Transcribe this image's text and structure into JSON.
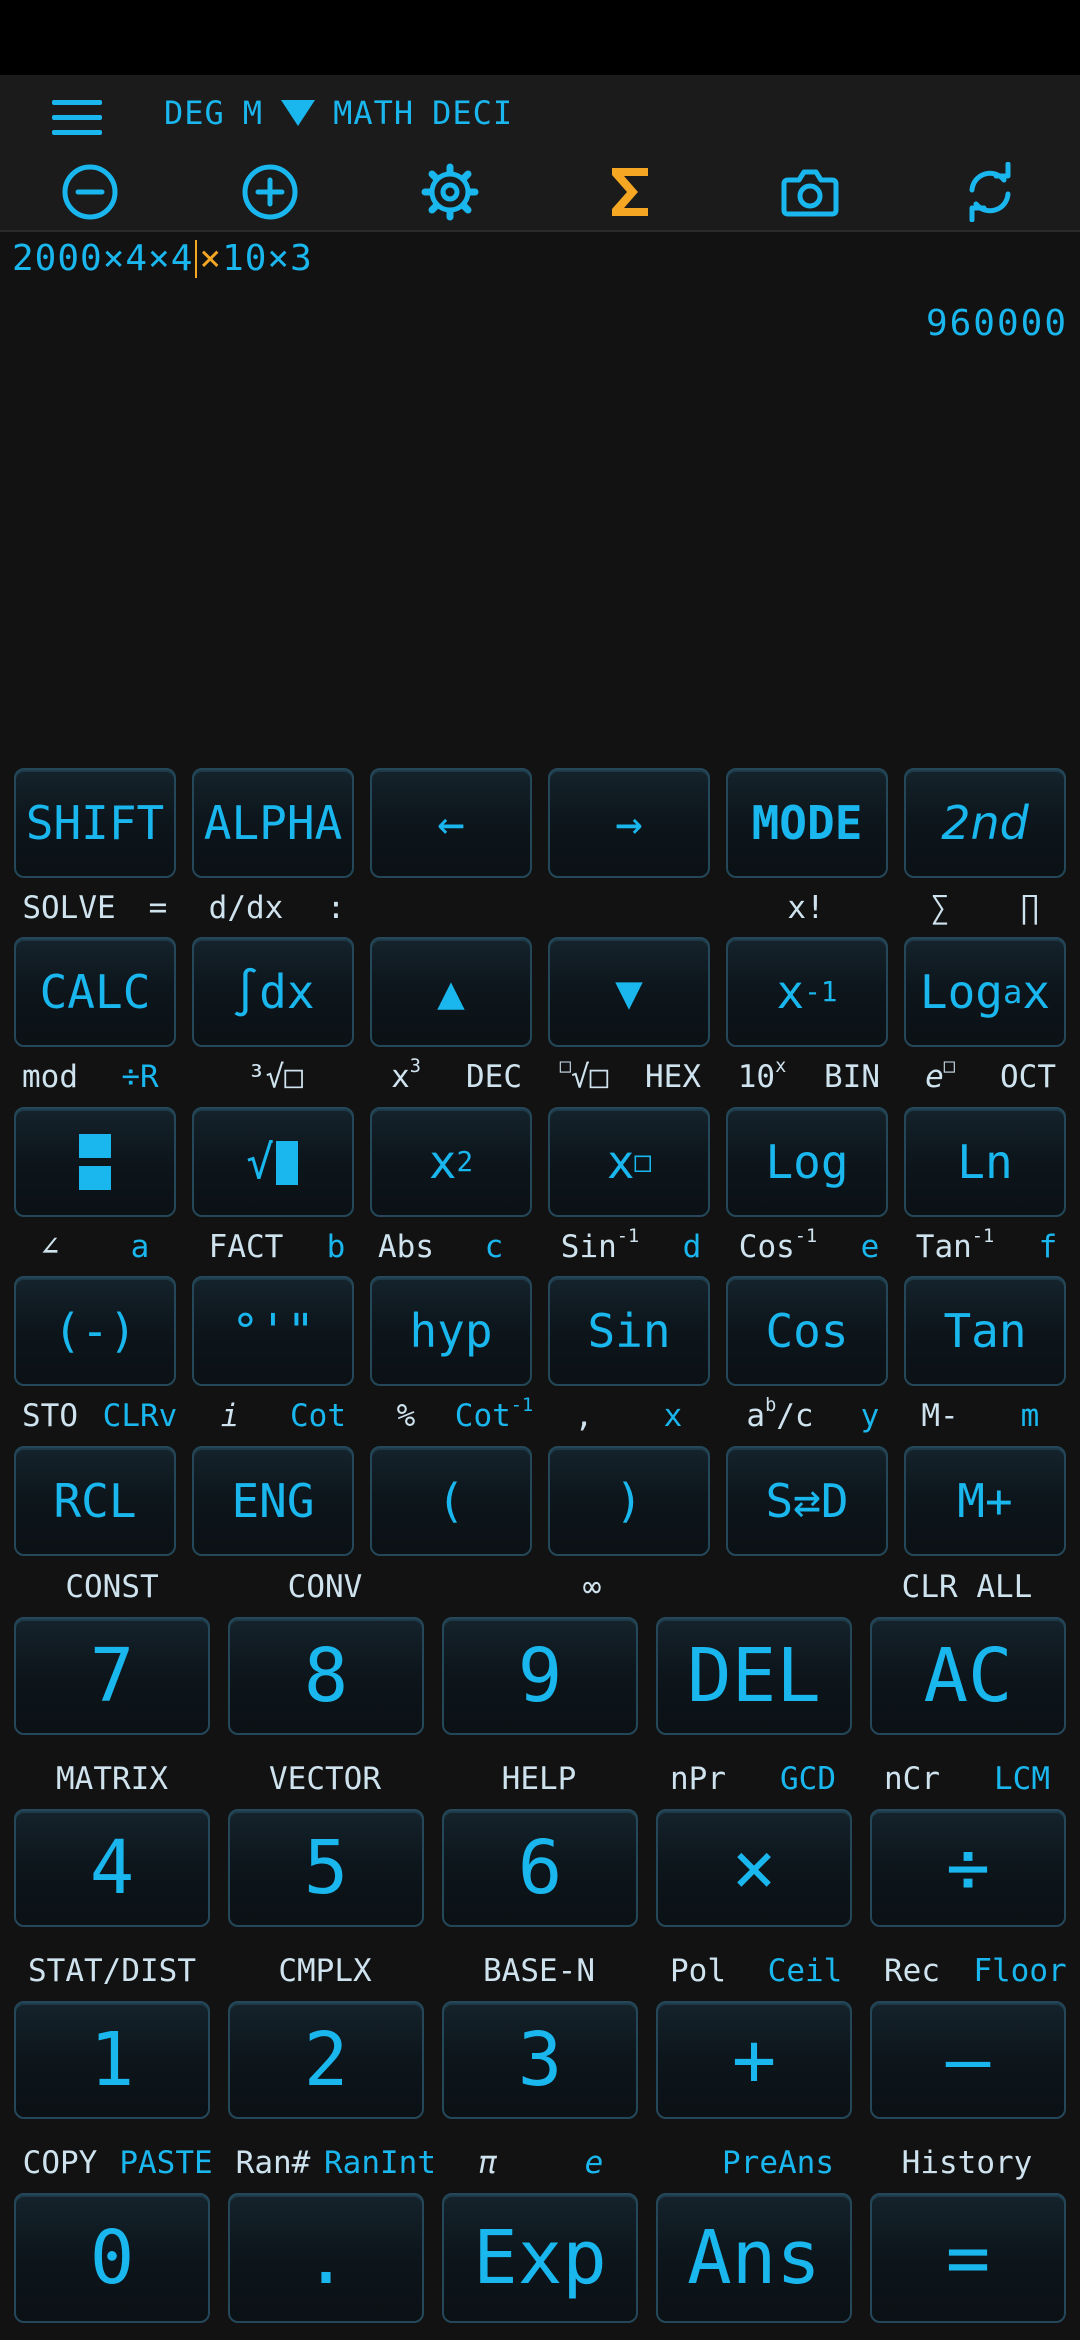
{
  "header": {
    "angle_mode": "DEG",
    "memory_indicator": "M",
    "input_mode": "MATH",
    "output_mode": "DECI"
  },
  "toolbar": {
    "icons": [
      "zoom-out-icon",
      "zoom-in-icon",
      "settings-icon",
      "sigma-icon",
      "camera-icon",
      "sync-icon"
    ],
    "accent_color": "#f5a623"
  },
  "display": {
    "expression_before_cursor": "2000×4×4",
    "expression_highlight": "×",
    "expression_after": "10×3",
    "result": "960000"
  },
  "rows": {
    "r1": {
      "keys": [
        "SHIFT",
        "ALPHA",
        "←",
        "→",
        "MODE",
        "2nd"
      ],
      "labels": [
        "SOLVE",
        "=",
        "d/dx",
        ":",
        "x!",
        "∑",
        "∏"
      ]
    },
    "r2": {
      "keys": [
        "CALC",
        "∫dx",
        "▲",
        "▼",
        "x",
        "Log"
      ],
      "key_sup": "-1",
      "key_logx_sub": "a",
      "key_logx_tail": "x",
      "labels": [
        "mod",
        "÷R",
        "³√□",
        "x",
        "DEC",
        "√□",
        "HEX",
        "10",
        "BIN",
        "e",
        "OCT"
      ],
      "label_sup_3": "3",
      "label_sup_x": "x",
      "label_box": "□"
    },
    "r3": {
      "keys": [
        "√",
        "x",
        "x",
        "Log",
        "Ln"
      ],
      "sup_2": "2",
      "sup_box": "□",
      "labels": [
        "∠",
        "a",
        "FACT",
        "b",
        "Abs",
        "c",
        "Sin",
        "d",
        "Cos",
        "e",
        "Tan",
        "f"
      ],
      "sup_neg1": "-1"
    },
    "r4": {
      "keys": [
        "(-)",
        "°'\"",
        "hyp",
        "Sin",
        "Cos",
        "Tan"
      ],
      "labels": [
        "STO",
        "CLRv",
        "i",
        "Cot",
        "%",
        "Cot",
        "‚",
        "x",
        "a",
        "/c",
        "y",
        "M-",
        "m"
      ],
      "sup_neg1": "-1",
      "sup_b": "b"
    },
    "r5": {
      "keys": [
        "RCL",
        "ENG",
        "(",
        ")",
        "S⇄D",
        "M+"
      ],
      "labels": [
        "CONST",
        "CONV",
        "∞",
        "CLR ALL"
      ]
    },
    "r6": {
      "keys": [
        "7",
        "8",
        "9",
        "DEL",
        "AC"
      ],
      "labels": [
        "MATRIX",
        "VECTOR",
        "HELP",
        "nPr",
        "GCD",
        "nCr",
        "LCM"
      ]
    },
    "r7": {
      "keys": [
        "4",
        "5",
        "6",
        "×",
        "÷"
      ],
      "labels": [
        "STAT/DIST",
        "CMPLX",
        "BASE-N",
        "Pol",
        "Ceil",
        "Rec",
        "Floor"
      ]
    },
    "r8": {
      "keys": [
        "1",
        "2",
        "3",
        "+",
        "–"
      ],
      "labels": [
        "COPY",
        "PASTE",
        "Ran#",
        "RanInt",
        "π",
        "e",
        "PreAns",
        "History"
      ]
    },
    "r9": {
      "keys": [
        "0",
        ".",
        "Exp",
        "Ans",
        "="
      ]
    }
  }
}
